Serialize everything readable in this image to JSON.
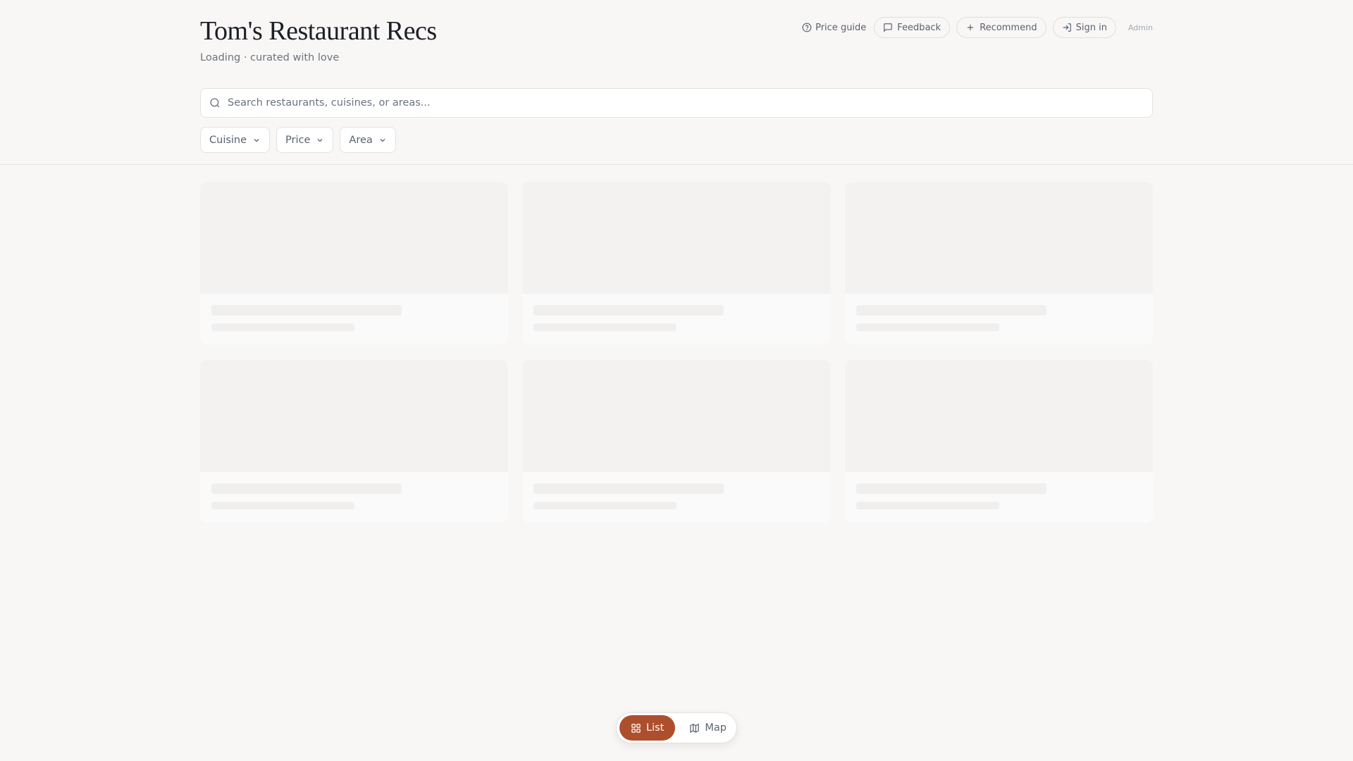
{
  "header": {
    "title": "Tom's Restaurant Recs",
    "subtitle": "Loading · curated with love",
    "actions": {
      "price_guide": "Price guide",
      "feedback": "Feedback",
      "recommend": "Recommend",
      "sign_in": "Sign in",
      "admin": "Admin"
    }
  },
  "search": {
    "placeholder": "Search restaurants, cuisines, or areas..."
  },
  "filters": {
    "cuisine": "Cuisine",
    "price": "Price",
    "area": "Area"
  },
  "view_toggle": {
    "list": "List",
    "map": "Map",
    "active": "List",
    "accent": "#ad4f2c"
  }
}
